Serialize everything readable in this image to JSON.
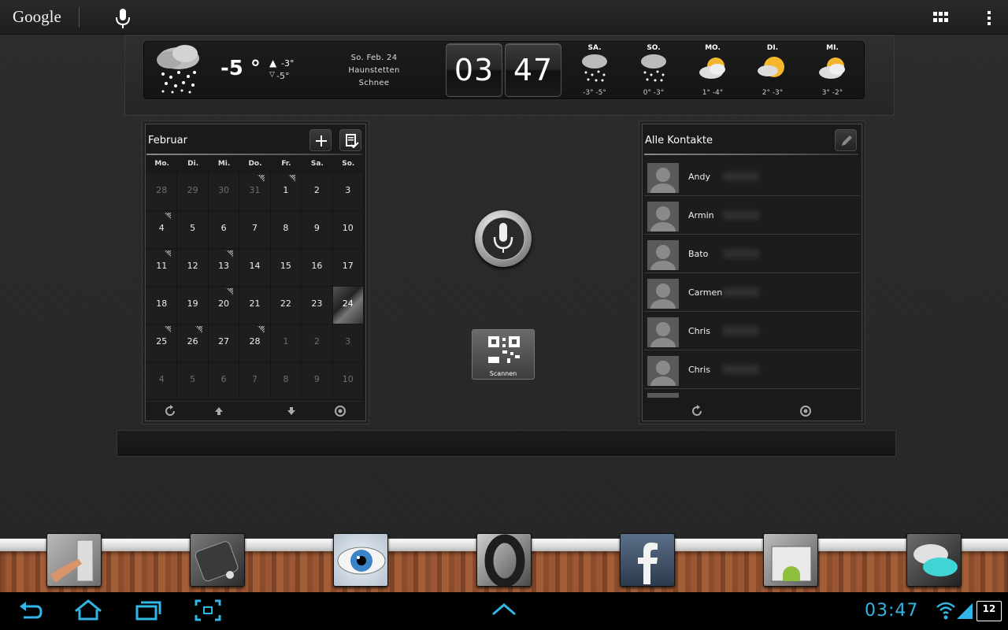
{
  "topbar": {
    "logo": "Google"
  },
  "weather": {
    "current_temp": "-5 °",
    "high": "-3°",
    "low": "-5°",
    "date": "So. Feb. 24",
    "location": "Haunstetten",
    "condition": "Schnee",
    "forecast": [
      {
        "day": "SA.",
        "temps": "-3° -5°",
        "icon": "snow-icon"
      },
      {
        "day": "SO.",
        "temps": "0° -3°",
        "icon": "snow-icon"
      },
      {
        "day": "MO.",
        "temps": "1° -4°",
        "icon": "partly-cloudy-icon"
      },
      {
        "day": "DI.",
        "temps": "2° -3°",
        "icon": "partly-cloudy-icon"
      },
      {
        "day": "MI.",
        "temps": "3° -2°",
        "icon": "partly-cloudy-icon"
      }
    ]
  },
  "clock": {
    "hours": "03",
    "minutes": "47"
  },
  "calendar": {
    "month": "Februar",
    "weekdays": [
      "Mo.",
      "Di.",
      "Mi.",
      "Do.",
      "Fr.",
      "Sa.",
      "So."
    ],
    "days": [
      {
        "d": "28",
        "dim": true
      },
      {
        "d": "29",
        "dim": true
      },
      {
        "d": "30",
        "dim": true
      },
      {
        "d": "31",
        "dim": true,
        "ev": true
      },
      {
        "d": "1",
        "ev": true
      },
      {
        "d": "2"
      },
      {
        "d": "3"
      },
      {
        "d": "4",
        "ev": true
      },
      {
        "d": "5"
      },
      {
        "d": "6"
      },
      {
        "d": "7"
      },
      {
        "d": "8"
      },
      {
        "d": "9"
      },
      {
        "d": "10"
      },
      {
        "d": "11",
        "ev": true
      },
      {
        "d": "12"
      },
      {
        "d": "13",
        "ev": true
      },
      {
        "d": "14"
      },
      {
        "d": "15"
      },
      {
        "d": "16"
      },
      {
        "d": "17"
      },
      {
        "d": "18"
      },
      {
        "d": "19"
      },
      {
        "d": "20",
        "ev": true
      },
      {
        "d": "21"
      },
      {
        "d": "22"
      },
      {
        "d": "23"
      },
      {
        "d": "24",
        "today": true
      },
      {
        "d": "25",
        "ev": true
      },
      {
        "d": "26",
        "ev": true
      },
      {
        "d": "27"
      },
      {
        "d": "28",
        "ev": true
      },
      {
        "d": "1",
        "dim": true
      },
      {
        "d": "2",
        "dim": true
      },
      {
        "d": "3",
        "dim": true
      },
      {
        "d": "4",
        "dim": true
      },
      {
        "d": "5",
        "dim": true
      },
      {
        "d": "6",
        "dim": true
      },
      {
        "d": "7",
        "dim": true
      },
      {
        "d": "8",
        "dim": true
      },
      {
        "d": "9",
        "dim": true
      },
      {
        "d": "10",
        "dim": true
      }
    ]
  },
  "scanner": {
    "label": "Scannen"
  },
  "contacts": {
    "title": "Alle Kontakte",
    "items": [
      "Andy",
      "Armin",
      "Bato",
      "Carmen",
      "Chris",
      "Chris"
    ]
  },
  "dock": {
    "apps": [
      "door-app-icon",
      "phone-app-icon",
      "eye-app-icon",
      "opera-icon",
      "facebook-icon",
      "market-icon",
      "messaging-icon"
    ]
  },
  "sysbar": {
    "time": "03:47",
    "battery": "12"
  },
  "colors": {
    "accent": "#33b5e5",
    "wood": "#8a4c2a",
    "panel": "#1a1a1a"
  }
}
